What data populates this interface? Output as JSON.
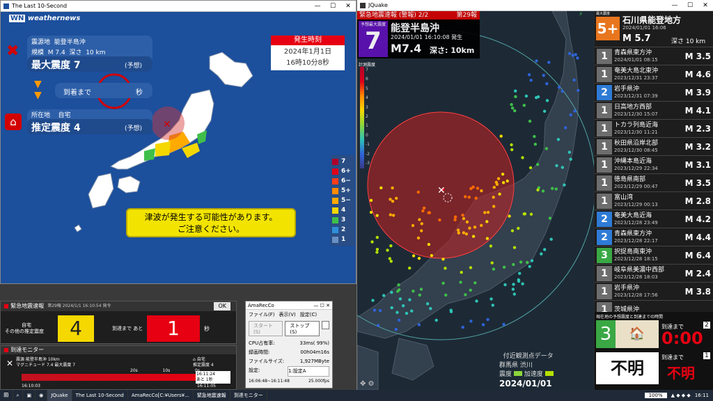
{
  "w1": {
    "title": "The Last 10-Second",
    "logo": "weathernews",
    "epicenter_label": "震源地",
    "epicenter": "能登半島沖",
    "scale_label": "規模",
    "magnitude": "M 7.4",
    "depth_label": "深さ",
    "depth": "10 km",
    "max_intensity": "最大震度 7",
    "forecast": "(予想)",
    "arrival_label": "到着まで",
    "arrival_unit": "秒",
    "location_label": "所在地",
    "location": "自宅",
    "est_intensity": "推定震度 4",
    "forecast2": "(予想)",
    "time_header": "発生時刻",
    "date": "2024年1月1日",
    "time": "16時10分8秒",
    "tsunami_line1": "津波が発生する可能性があります。",
    "tsunami_line2": "ご注意ください。",
    "legend": [
      {
        "label": "7",
        "color": "#b0002a"
      },
      {
        "label": "6+",
        "color": "#e0001a"
      },
      {
        "label": "6−",
        "color": "#ff3d1a"
      },
      {
        "label": "5+",
        "color": "#ff8a00"
      },
      {
        "label": "5−",
        "color": "#ffaa00"
      },
      {
        "label": "4",
        "color": "#f5d800"
      },
      {
        "label": "3",
        "color": "#3fbf4a"
      },
      {
        "label": "2",
        "color": "#2e8fd9"
      },
      {
        "label": "1",
        "color": "#6a8fc2"
      }
    ]
  },
  "w2": {
    "title": "JQuake",
    "alert_title": "緊急地震速報 (警報) 2/2",
    "alert_num": "第29報",
    "max_label": "予想最大震度",
    "intensity": "7",
    "region": "能登半島沖",
    "datetime": "2024/01/01 16:10:08 発生",
    "magnitude": "M7.4",
    "depth": "深さ: 10km",
    "scale_label": "計測震度",
    "scale_ticks": [
      "7",
      "6",
      "5",
      "4",
      "3",
      "2",
      "1",
      "0",
      "-1",
      "-2",
      "-3"
    ],
    "station_note": "付近観測点データ",
    "station_name": "群馬県 渋川",
    "legend_intensity": "震度",
    "legend_accel": "加速度",
    "clock": "2024/01/01 16:11:02",
    "side": {
      "top_label": "最大震度",
      "top_int": "5+",
      "top_region": "石川県能登地方",
      "top_time": "2024/01/01 16:06",
      "top_mag": "M 5.7",
      "top_depth": "深さ 10 km",
      "list": [
        {
          "int": "1",
          "region": "青森県東方沖",
          "time": "2024/01/01 08:15",
          "mag": "M 3.5",
          "color": "#6d6d6d"
        },
        {
          "int": "1",
          "region": "奄美大島北東沖",
          "time": "2023/12/31 23:37",
          "mag": "M 4.6",
          "color": "#6d6d6d"
        },
        {
          "int": "2",
          "region": "岩手県沖",
          "time": "2023/12/31 07:39",
          "mag": "M 3.9",
          "color": "#2e7bd6"
        },
        {
          "int": "1",
          "region": "日高地方西部",
          "time": "2023/12/30 15:07",
          "mag": "M 4.1",
          "color": "#6d6d6d"
        },
        {
          "int": "1",
          "region": "トカラ列島近海",
          "time": "2023/12/30 11:21",
          "mag": "M 2.3",
          "color": "#6d6d6d"
        },
        {
          "int": "1",
          "region": "秋田県沿岸北部",
          "time": "2023/12/30 08:45",
          "mag": "M 3.2",
          "color": "#6d6d6d"
        },
        {
          "int": "1",
          "region": "沖縄本島近海",
          "time": "2023/12/29 22:34",
          "mag": "M 3.1",
          "color": "#6d6d6d"
        },
        {
          "int": "1",
          "region": "徳島県南部",
          "time": "2023/12/29 00:47",
          "mag": "M 3.5",
          "color": "#6d6d6d"
        },
        {
          "int": "1",
          "region": "富山湾",
          "time": "2023/12/29 00:13",
          "mag": "M 2.8",
          "color": "#6d6d6d"
        },
        {
          "int": "2",
          "region": "奄美大島近海",
          "time": "2023/12/28 23:49",
          "mag": "M 4.2",
          "color": "#2e7bd6"
        },
        {
          "int": "2",
          "region": "青森県東方沖",
          "time": "2023/12/28 22:17",
          "mag": "M 4.4",
          "color": "#2e7bd6"
        },
        {
          "int": "3",
          "region": "択捉島南東沖",
          "time": "2023/12/28 18:15",
          "mag": "M 6.4",
          "color": "#3aa845"
        },
        {
          "int": "1",
          "region": "岐阜県美濃中西部",
          "time": "2023/12/28 18:03",
          "mag": "M 2.4",
          "color": "#6d6d6d"
        },
        {
          "int": "1",
          "region": "岩手県沖",
          "time": "2023/12/28 17:56",
          "mag": "M 3.8",
          "color": "#6d6d6d"
        },
        {
          "int": "1",
          "region": "茨城県沖",
          "time": "",
          "mag": "",
          "color": "#6d6d6d"
        }
      ],
      "current_label": "現在地の予想震度と到達までの時間",
      "current_int": "3",
      "arrival_label": "到達まで",
      "arrival_idx": "2",
      "arrival_time": "0:00",
      "unknown": "不明",
      "arrival_label2": "到達まで",
      "arrival_idx2": "1",
      "unknown2": "不明"
    }
  },
  "w3": {
    "header": "緊急地震速報",
    "info": "第29報 2024/1/1 16:10:54 発令",
    "ok": "OK",
    "loc": "自宅",
    "est_label": "その他の推定震度",
    "intensity": "4",
    "arrival_label": "到達まで あと",
    "seconds": "1",
    "sec_unit": "秒"
  },
  "w4": {
    "header": "到達モニター",
    "epicenter": "震源 能登半島沖 10km",
    "magnitude": "マグニチュード 7.4 最大震度 7",
    "home": "自宅",
    "est": "推定震度 4",
    "ticks": [
      "20s",
      "10s",
      "0s"
    ],
    "time_left": "16:10:03",
    "time_right": "16:11:05",
    "box1": "16:11:24",
    "box2": "あと 1秒"
  },
  "w5": {
    "title": "AmaRecCo",
    "menu": [
      "ファイル(F)",
      "表示(V)",
      "設定(C)"
    ],
    "start": "スタート(S)",
    "stop": "ストップ(S)",
    "cpu_label": "CPU占有率:",
    "cpu": "33ms( 99%)",
    "time_label": "録画時間:",
    "time": "00h04m16s",
    "size_label": "ファイルサイズ:",
    "size": "1,927MByte",
    "setting_label": "設定:",
    "setting": "1:設定A",
    "range": "16:06:48~16:11:48",
    "fps": "25.000fps"
  },
  "taskbar": {
    "items": [
      "JQuake",
      "The Last 10-Second",
      "AmaRecCo[C:¥Users¥...",
      "緊急地震速報",
      "到達モニター"
    ],
    "zoom": "100%",
    "clock": "16:11"
  }
}
